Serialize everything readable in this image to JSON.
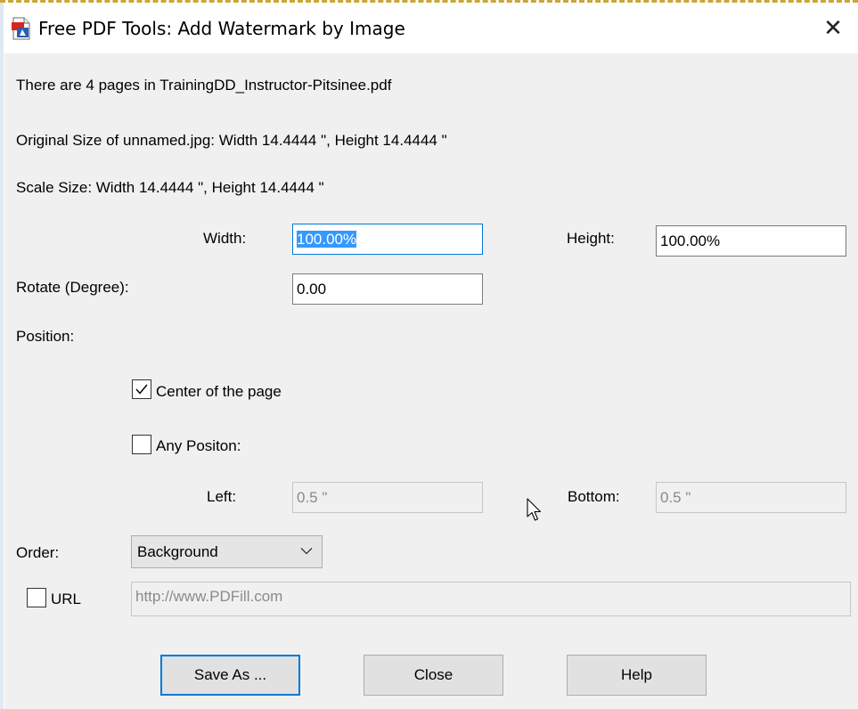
{
  "window": {
    "title": "Free PDF Tools: Add Watermark by Image",
    "close_glyph": "✕",
    "icon": "pdf-tools-app-icon"
  },
  "info": {
    "pages_line": "There are 4 pages in TrainingDD_Instructor-Pitsinee.pdf",
    "original_size_line": "Original Size of unnamed.jpg:  Width 14.4444 \",   Height 14.4444 \"",
    "scale_size_line": "Scale Size:  Width 14.4444 \",   Height 14.4444 \""
  },
  "size": {
    "width_label": "Width:",
    "width_value": "100.00%",
    "height_label": "Height:",
    "height_value": "100.00%"
  },
  "rotate": {
    "label": "Rotate (Degree):",
    "value": "0.00"
  },
  "position": {
    "label": "Position:",
    "center": {
      "label": "Center of the page",
      "checked": true
    },
    "any": {
      "label": "Any Positon:",
      "checked": false
    },
    "left_label": "Left:",
    "left_value": "0.5 \"",
    "bottom_label": "Bottom:",
    "bottom_value": "0.5 \""
  },
  "order": {
    "label": "Order:",
    "selected": "Background"
  },
  "url": {
    "label": "URL",
    "checked": false,
    "value": "http://www.PDFill.com"
  },
  "buttons": {
    "save_as": "Save As ...",
    "close": "Close",
    "help": "Help"
  },
  "colors": {
    "dialog_bg": "#f0f0f0",
    "focus_border": "#0078d7",
    "selection": "#3399ff"
  }
}
